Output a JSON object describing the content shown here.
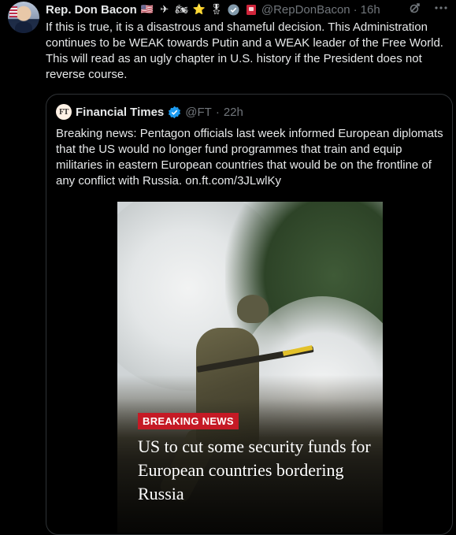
{
  "tweet": {
    "author_name": "Rep. Don Bacon",
    "badges": [
      "🇺🇸",
      "✈",
      "🏍",
      "⭐",
      "🎖",
      "✔",
      "📕"
    ],
    "handle": "@RepDonBacon",
    "separator": "·",
    "time": "16h",
    "icons": [
      "grok-icon",
      "more-icon"
    ],
    "text": "If this is true, it is a disastrous and shameful decision. This Administration continues to be WEAK towards Putin and a WEAK leader of the Free World. This will read as an ugly chapter in U.S. history if the President does not reverse course."
  },
  "quote": {
    "logo_text": "FT",
    "author_name": "Financial Times",
    "handle": "@FT",
    "separator": "·",
    "time": "22h",
    "text": "Breaking news: Pentagon officials last week informed European diplomats that the US would no longer fund programmes that train and equip militaries in eastern European countries that would be on the frontline of any conflict with Russia. on.ft.com/3JLwlKy",
    "media": {
      "badge": "BREAKING NEWS",
      "headline": "US to cut some security funds for European countries bordering Russia",
      "badge_color": "#c51a25"
    }
  },
  "colors": {
    "background": "#000000",
    "text": "#e7e9ea",
    "muted": "#71767b",
    "border": "#2f3336",
    "verified": "#1d9bf0"
  }
}
